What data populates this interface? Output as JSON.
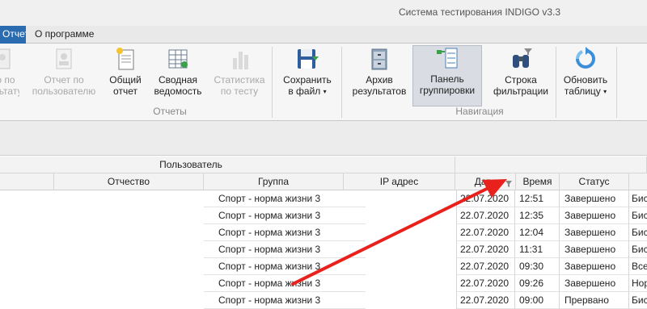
{
  "window": {
    "title": "Система тестирования INDIGO v3.3"
  },
  "tabs": {
    "active": "Отчеты",
    "about": "О программе"
  },
  "ribbon": {
    "reports_group": {
      "label": "Отчеты",
      "buttons": {
        "by_test": {
          "line1": "о по",
          "line2": "ультату"
        },
        "by_user": {
          "line1": "Отчет по",
          "line2": "пользователю"
        },
        "general": {
          "line1": "Общий",
          "line2": "отчет"
        },
        "summary": {
          "line1": "Сводная",
          "line2": "ведомость"
        },
        "stats": {
          "line1": "Статистика",
          "line2": "по тесту"
        },
        "save": {
          "line1": "Сохранить",
          "line2": "в файл",
          "caret": "▾"
        }
      }
    },
    "nav_group": {
      "label": "Навигация",
      "buttons": {
        "archive": {
          "line1": "Архив",
          "line2": "результатов"
        },
        "grouping": {
          "line1": "Панель",
          "line2": "группировки"
        },
        "filter": {
          "line1": "Строка",
          "line2": "фильтрации"
        },
        "refresh": {
          "line1": "Обновить",
          "line2": "таблицу",
          "caret": "▾"
        }
      }
    }
  },
  "grid": {
    "band": {
      "user": "Пользователь"
    },
    "columns": {
      "patronymic": "Отчество",
      "group": "Группа",
      "ip": "IP адрес",
      "date": "Дата",
      "time": "Время",
      "status": "Статус"
    },
    "rows": [
      {
        "group": "Спорт - норма жизни 3",
        "date": "22.07.2020",
        "time": "12:51",
        "status": "Завершено",
        "extra": "Бис"
      },
      {
        "group": "Спорт - норма жизни 3",
        "date": "22.07.2020",
        "time": "12:35",
        "status": "Завершено",
        "extra": "Бис"
      },
      {
        "group": "Спорт - норма жизни 3",
        "date": "22.07.2020",
        "time": "12:04",
        "status": "Завершено",
        "extra": "Бис"
      },
      {
        "group": "Спорт - норма жизни 3",
        "date": "22.07.2020",
        "time": "11:31",
        "status": "Завершено",
        "extra": "Бис"
      },
      {
        "group": "Спорт - норма жизни 3",
        "date": "22.07.2020",
        "time": "09:30",
        "status": "Завершено",
        "extra": "Все"
      },
      {
        "group": "Спорт - норма жизни 3",
        "date": "22.07.2020",
        "time": "09:26",
        "status": "Завершено",
        "extra": "Нор"
      },
      {
        "group": "Спорт - норма жизни 3",
        "date": "22.07.2020",
        "time": "09:00",
        "status": "Прервано",
        "extra": "Бис"
      }
    ]
  },
  "annotation": {
    "arrow_color": "#e8211d"
  }
}
